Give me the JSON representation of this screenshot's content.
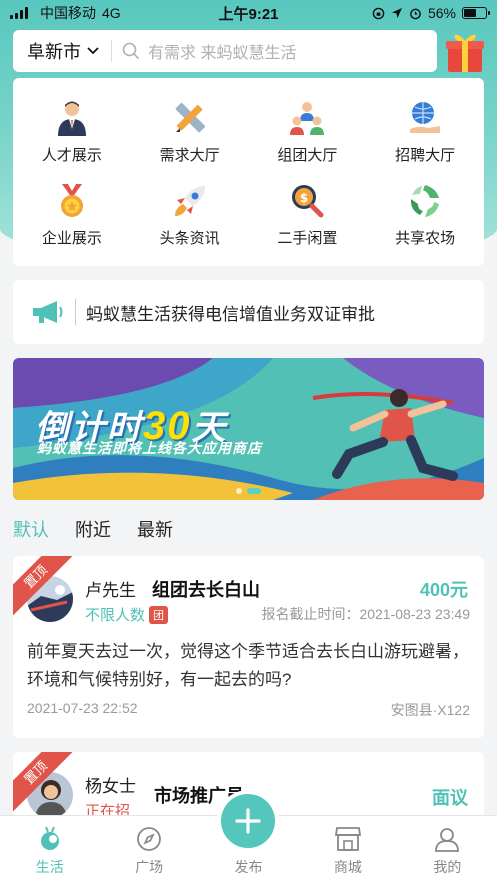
{
  "status_bar": {
    "carrier": "中国移动",
    "network": "4G",
    "time": "上午9:21",
    "battery": "56%",
    "battery_level": 0.56
  },
  "search": {
    "city": "阜新市",
    "placeholder": "有需求 来蚂蚁慧生活"
  },
  "menu": [
    {
      "label": "人才展示",
      "icon": "businessman-icon"
    },
    {
      "label": "需求大厅",
      "icon": "pencil-ruler-icon"
    },
    {
      "label": "组团大厅",
      "icon": "group-icon"
    },
    {
      "label": "招聘大厅",
      "icon": "globe-hand-icon"
    },
    {
      "label": "企业展示",
      "icon": "medal-icon"
    },
    {
      "label": "头条资讯",
      "icon": "rocket-icon"
    },
    {
      "label": "二手闲置",
      "icon": "magnifier-coin-icon"
    },
    {
      "label": "共享农场",
      "icon": "leaf-cycle-icon"
    }
  ],
  "notice": {
    "text": "蚂蚁慧生活获得电信增值业务双证审批"
  },
  "banner": {
    "title_prefix": "倒计时",
    "title_number": "30",
    "title_suffix": "天",
    "subtitle": "蚂蚁慧生活即将上线各大应用商店",
    "slide_count": 2,
    "active_slide": 2
  },
  "feed_tabs": [
    "默认",
    "附近",
    "最新"
  ],
  "posts": [
    {
      "badge": "置顶",
      "author": "卢先生",
      "title": "组团去长白山",
      "price": "400元",
      "limit": "不限人数",
      "type_tag": "团",
      "deadline": "报名截止时间：2021-08-23 23:49",
      "content": "前年夏天去过一次，觉得这个季节适合去长白山游玩避暑，环境和气候特别好，有一起去的吗?",
      "date": "2021-07-23 22:52",
      "location": "安图县·X122"
    },
    {
      "badge": "置顶",
      "author": "杨女士",
      "title": "市场推广员",
      "price": "面议",
      "status": "正在招"
    }
  ],
  "tabbar": [
    {
      "label": "生活",
      "icon": "ant-icon",
      "active": true
    },
    {
      "label": "广场",
      "icon": "compass-icon"
    },
    {
      "label": "发布",
      "icon": "plus-icon"
    },
    {
      "label": "商城",
      "icon": "store-icon"
    },
    {
      "label": "我的",
      "icon": "user-icon"
    }
  ],
  "colors": {
    "accent": "#4fc1b6",
    "hero": "#58c7bd",
    "badge": "#e0544a"
  }
}
